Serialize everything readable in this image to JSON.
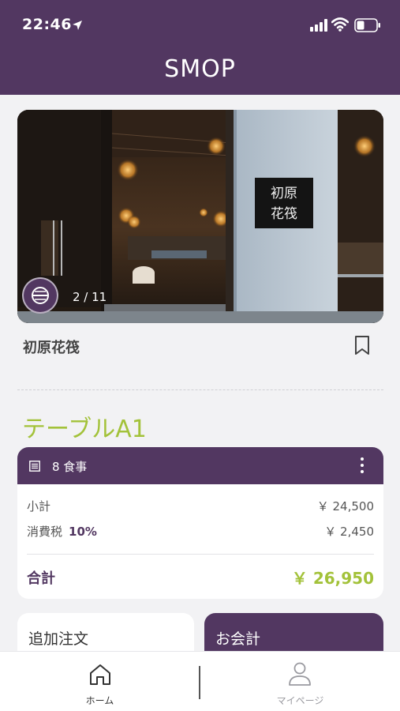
{
  "status_bar": {
    "time": "22:46",
    "icons": [
      "location-arrow-icon",
      "signal-icon",
      "wifi-icon",
      "battery-icon"
    ]
  },
  "header": {
    "logo": "SMOP"
  },
  "hero": {
    "counter": "2 / 11",
    "sign_text": "初原花筏",
    "badge_icon": "shop-badge-icon"
  },
  "shop": {
    "name": "初原花筏",
    "bookmark_icon": "bookmark-icon"
  },
  "table": {
    "title": "テーブルA1"
  },
  "order": {
    "item_count": "8 食事",
    "subtotal_label": "小計",
    "subtotal_value": "￥ 24,500",
    "tax_label": "消費税",
    "tax_rate": "10%",
    "tax_value": "￥ 2,450",
    "total_label": "合計",
    "total_value": "￥ 26,950"
  },
  "actions": {
    "add_order": "追加注文",
    "checkout": "お会計"
  },
  "tabbar": {
    "home": "ホーム",
    "mypage": "マイページ"
  },
  "colors": {
    "brand_purple": "#523761",
    "accent_green": "#a3c23a"
  }
}
